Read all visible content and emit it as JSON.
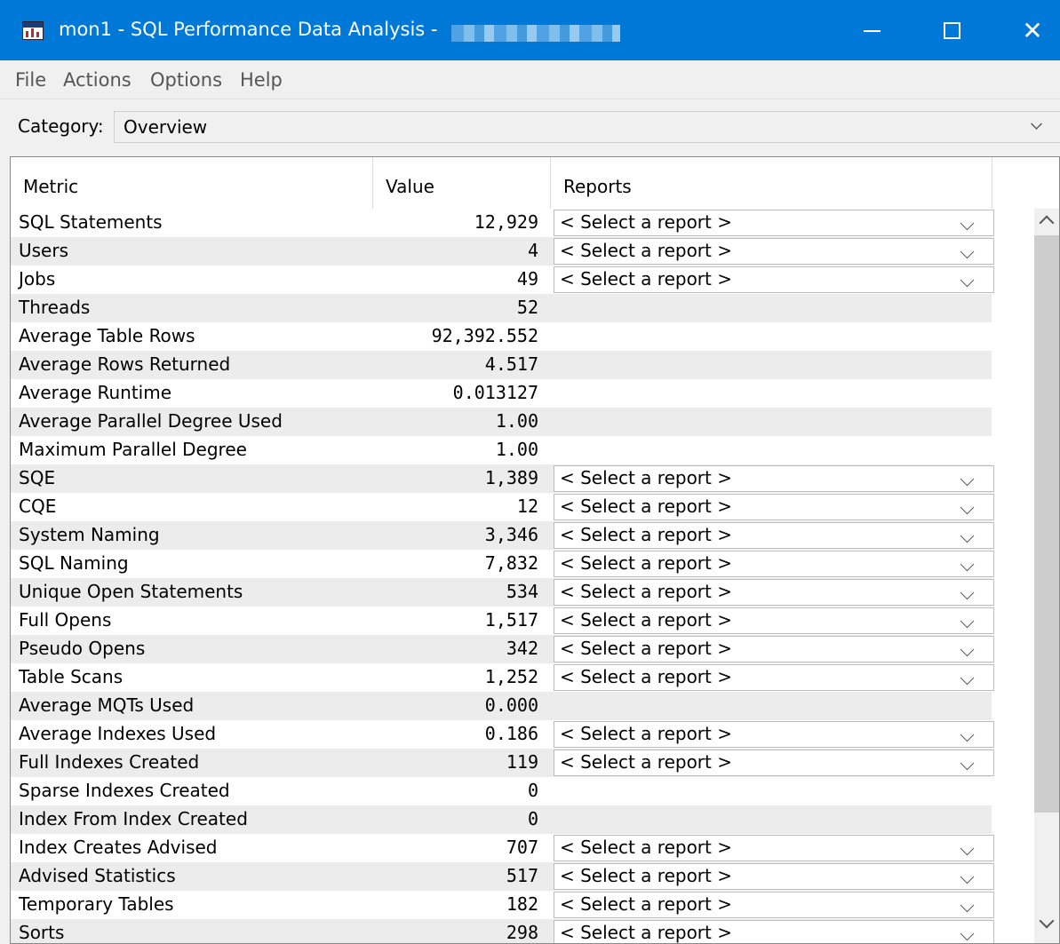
{
  "window": {
    "title": "mon1 - SQL Performance Data Analysis - ",
    "minimize_label": "",
    "maximize_label": "",
    "close_label": "✕"
  },
  "menu": [
    "File",
    "Actions",
    "Options",
    "Help"
  ],
  "category": {
    "label": "Category:",
    "value": "Overview"
  },
  "table": {
    "headers": [
      "Metric",
      "Value",
      "Reports"
    ],
    "rows": [
      {
        "metric": "SQL Statements",
        "value": "12,929",
        "report": "< Select a report >"
      },
      {
        "metric": "Users",
        "value": "4",
        "report": "< Select a report >"
      },
      {
        "metric": "Jobs",
        "value": "49",
        "report": "< Select a report >"
      },
      {
        "metric": "Threads",
        "value": "52",
        "report": null
      },
      {
        "metric": "Average Table Rows",
        "value": "92,392.552",
        "report": null
      },
      {
        "metric": "Average Rows Returned",
        "value": "4.517",
        "report": null
      },
      {
        "metric": "Average Runtime",
        "value": "0.013127",
        "report": null
      },
      {
        "metric": "Average Parallel Degree Used",
        "value": "1.00",
        "report": null
      },
      {
        "metric": "Maximum Parallel Degree",
        "value": "1.00",
        "report": null
      },
      {
        "metric": "SQE",
        "value": "1,389",
        "report": "< Select a report >"
      },
      {
        "metric": "CQE",
        "value": "12",
        "report": "< Select a report >"
      },
      {
        "metric": "System Naming",
        "value": "3,346",
        "report": "< Select a report >"
      },
      {
        "metric": "SQL Naming",
        "value": "7,832",
        "report": "< Select a report >"
      },
      {
        "metric": "Unique Open Statements",
        "value": "534",
        "report": "< Select a report >"
      },
      {
        "metric": "Full Opens",
        "value": "1,517",
        "report": "< Select a report >"
      },
      {
        "metric": "Pseudo Opens",
        "value": "342",
        "report": "< Select a report >"
      },
      {
        "metric": "Table Scans",
        "value": "1,252",
        "report": "< Select a report >"
      },
      {
        "metric": "Average MQTs Used",
        "value": "0.000",
        "report": null
      },
      {
        "metric": "Average Indexes Used",
        "value": "0.186",
        "report": "< Select a report >"
      },
      {
        "metric": "Full Indexes Created",
        "value": "119",
        "report": "< Select a report >"
      },
      {
        "metric": "Sparse Indexes Created",
        "value": "0",
        "report": null
      },
      {
        "metric": "Index From Index Created",
        "value": "0",
        "report": null
      },
      {
        "metric": "Index Creates Advised",
        "value": "707",
        "report": "< Select a report >"
      },
      {
        "metric": "Advised Statistics",
        "value": "517",
        "report": "< Select a report >"
      },
      {
        "metric": "Temporary Tables",
        "value": "182",
        "report": "< Select a report >"
      },
      {
        "metric": "Sorts",
        "value": "298",
        "report": "< Select a report >"
      }
    ]
  },
  "colors": {
    "titlebar": "#0078d7",
    "row_alt": "#ececec",
    "background": "#f0f0f0"
  }
}
